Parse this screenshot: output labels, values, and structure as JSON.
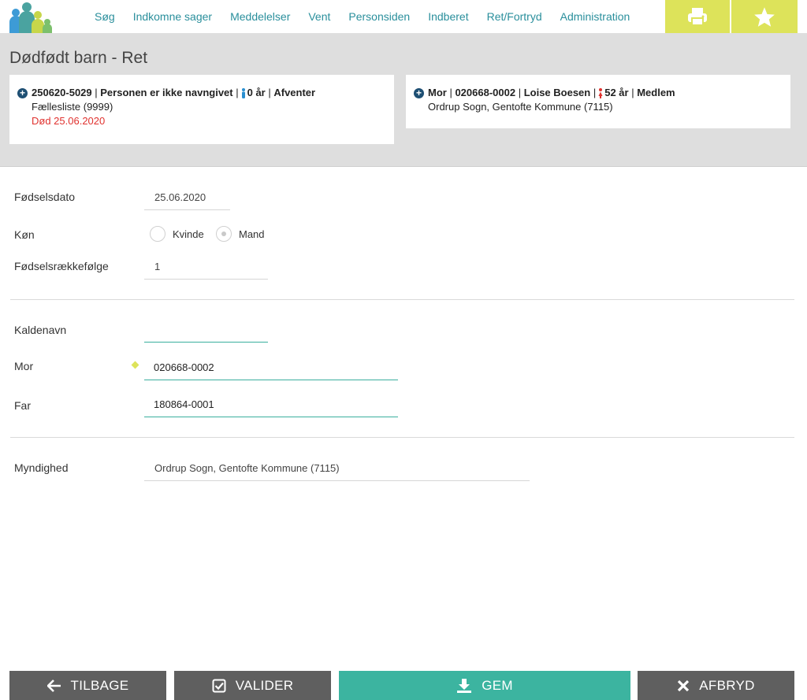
{
  "nav": {
    "items": [
      "Søg",
      "Indkomne sager",
      "Meddelelser",
      "Vent",
      "Personsiden",
      "Indberet",
      "Ret/Fortryd",
      "Administration"
    ]
  },
  "header": {
    "title": "Dødfødt barn - Ret",
    "child_card": {
      "cpr": "250620-5029",
      "name_status": "Personen er ikke navngivet",
      "age": "0 år",
      "status": "Afventer",
      "list": "Fællesliste (9999)",
      "death": "Død 25.06.2020"
    },
    "mother_card": {
      "role": "Mor",
      "cpr": "020668-0002",
      "name": "Loise Boesen",
      "age": "52 år",
      "membership": "Medlem",
      "parish": "Ordrup Sogn, Gentofte Kommune (7115)"
    }
  },
  "form": {
    "birthdate_label": "Fødselsdato",
    "birthdate_value": "25.06.2020",
    "gender_label": "Køn",
    "gender_option_female": "Kvinde",
    "gender_option_male": "Mand",
    "gender_selected": "Mand",
    "birth_order_label": "Fødselsrækkefølge",
    "birth_order_value": "1",
    "nickname_label": "Kaldenavn",
    "nickname_value": "",
    "mother_label": "Mor",
    "mother_value": "020668-0002",
    "father_label": "Far",
    "father_value": "180864-0001",
    "authority_label": "Myndighed",
    "authority_value": "Ordrup Sogn, Gentofte Kommune (7115)"
  },
  "footer": {
    "back_label": "TILBAGE",
    "validate_label": "VALIDER",
    "save_label": "GEM",
    "cancel_label": "AFBRYD"
  },
  "colors": {
    "accent_teal": "#3cb4a0",
    "nav_link": "#2a8f9c",
    "yellow": "#dde35a",
    "dark_button": "#5f5f5f",
    "death_red": "#e0322f"
  },
  "icons": [
    "logo-people-icon",
    "print-icon",
    "star-icon",
    "plus-circle-icon",
    "person-icon",
    "arrow-left-icon",
    "checkbox-icon",
    "download-icon",
    "close-icon"
  ]
}
